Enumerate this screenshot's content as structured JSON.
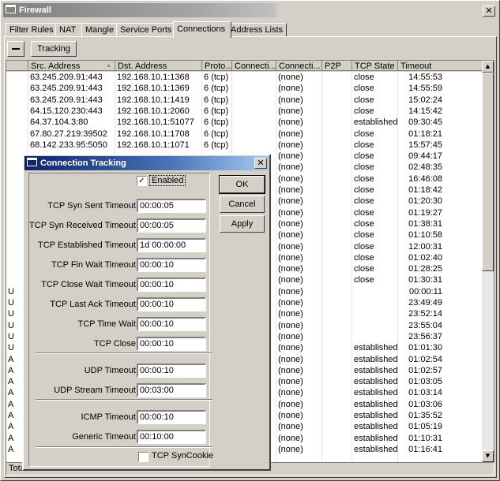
{
  "window": {
    "title": "Firewall",
    "close_glyph": "✕"
  },
  "tabs": [
    {
      "label": "Filter Rules",
      "active": false
    },
    {
      "label": "NAT",
      "active": false
    },
    {
      "label": "Mangle",
      "active": false
    },
    {
      "label": "Service Ports",
      "active": false
    },
    {
      "label": "Connections",
      "active": true
    },
    {
      "label": "Address Lists",
      "active": false
    }
  ],
  "toolbar": {
    "tracking_label": "Tracking",
    "menu_icon": "minus-icon"
  },
  "table": {
    "columns": [
      "Src. Address",
      "Dst. Address",
      "Proto...",
      "Connecti...",
      "Connecti...",
      "P2P",
      "TCP State",
      "Timeout"
    ],
    "sort_indicator": "▲",
    "rows": [
      {
        "flag": "",
        "src": "63.245.209.91:443",
        "dst": "192.168.10.1:1368",
        "proto": "6 (tcp)",
        "c2": "(none)",
        "state": "close",
        "timeout": "14:55:53"
      },
      {
        "flag": "",
        "src": "63.245.209.91:443",
        "dst": "192.168.10.1:1369",
        "proto": "6 (tcp)",
        "c2": "(none)",
        "state": "close",
        "timeout": "14:55:59"
      },
      {
        "flag": "",
        "src": "63.245.209.91:443",
        "dst": "192.168.10.1:1419",
        "proto": "6 (tcp)",
        "c2": "(none)",
        "state": "close",
        "timeout": "15:02:24"
      },
      {
        "flag": "",
        "src": "64.15.120.230:443",
        "dst": "192.168.10.1:2060",
        "proto": "6 (tcp)",
        "c2": "(none)",
        "state": "close",
        "timeout": "14:15:42"
      },
      {
        "flag": "",
        "src": "64.37.104.3:80",
        "dst": "192.168.10.1:51077",
        "proto": "6 (tcp)",
        "c2": "(none)",
        "state": "established",
        "timeout": "09:30:45"
      },
      {
        "flag": "",
        "src": "67.80.27.219:39502",
        "dst": "192.168.10.1:1708",
        "proto": "6 (tcp)",
        "c2": "(none)",
        "state": "close",
        "timeout": "01:18:21"
      },
      {
        "flag": "",
        "src": "68.142.233.95:5050",
        "dst": "192.168.10.1:1071",
        "proto": "6 (tcp)",
        "c2": "(none)",
        "state": "close",
        "timeout": "15:57:45"
      },
      {
        "flag": "",
        "src": "",
        "dst": "",
        "proto": "",
        "c2": "(none)",
        "state": "close",
        "timeout": "09:44:17"
      },
      {
        "flag": "",
        "src": "",
        "dst": "",
        "proto": "",
        "c2": "(none)",
        "state": "close",
        "timeout": "02:48:35"
      },
      {
        "flag": "",
        "src": "",
        "dst": "",
        "proto": "",
        "c2": "(none)",
        "state": "close",
        "timeout": "16:46:08"
      },
      {
        "flag": "",
        "src": "",
        "dst": "",
        "proto": "",
        "c2": "(none)",
        "state": "close",
        "timeout": "01:18:42"
      },
      {
        "flag": "",
        "src": "",
        "dst": "",
        "proto": "",
        "c2": "(none)",
        "state": "close",
        "timeout": "01:20:30"
      },
      {
        "flag": "",
        "src": "",
        "dst": "",
        "proto": "",
        "c2": "(none)",
        "state": "close",
        "timeout": "01:19:27"
      },
      {
        "flag": "",
        "src": "",
        "dst": "",
        "proto": "",
        "c2": "(none)",
        "state": "close",
        "timeout": "01:38:31"
      },
      {
        "flag": "",
        "src": "",
        "dst": "",
        "proto": "",
        "c2": "(none)",
        "state": "close",
        "timeout": "01:10:58"
      },
      {
        "flag": "",
        "src": "",
        "dst": "",
        "proto": "",
        "c2": "(none)",
        "state": "close",
        "timeout": "12:00:31"
      },
      {
        "flag": "",
        "src": "",
        "dst": "",
        "proto": "",
        "c2": "(none)",
        "state": "close",
        "timeout": "01:02:40"
      },
      {
        "flag": "",
        "src": "",
        "dst": "",
        "proto": "",
        "c2": "(none)",
        "state": "close",
        "timeout": "01:28:25"
      },
      {
        "flag": "",
        "src": "",
        "dst": "",
        "proto": "",
        "c2": "(none)",
        "state": "close",
        "timeout": "01:30:31"
      },
      {
        "flag": "U",
        "src": "",
        "dst": "",
        "proto": "",
        "c2": "(none)",
        "state": "",
        "timeout": "00:00:11"
      },
      {
        "flag": "U",
        "src": "",
        "dst": "",
        "proto": "",
        "c2": "(none)",
        "state": "",
        "timeout": "23:49:49"
      },
      {
        "flag": "U",
        "src": "",
        "dst": "",
        "proto": "",
        "c2": "(none)",
        "state": "",
        "timeout": "23:52:14"
      },
      {
        "flag": "U",
        "src": "",
        "dst": "",
        "proto": "",
        "c2": "(none)",
        "state": "",
        "timeout": "23:55:04"
      },
      {
        "flag": "U",
        "src": "",
        "dst": "",
        "proto": "",
        "c2": "(none)",
        "state": "",
        "timeout": "23:56:37"
      },
      {
        "flag": "U",
        "src": "",
        "dst": "",
        "proto": "",
        "c2": "(none)",
        "state": "established",
        "timeout": "01:01:30"
      },
      {
        "flag": "A",
        "src": "",
        "dst": "",
        "proto": "",
        "c2": "(none)",
        "state": "established",
        "timeout": "01:02:54"
      },
      {
        "flag": "A",
        "src": "",
        "dst": "",
        "proto": "",
        "c2": "(none)",
        "state": "established",
        "timeout": "01:02:57"
      },
      {
        "flag": "A",
        "src": "",
        "dst": "",
        "proto": "",
        "c2": "(none)",
        "state": "established",
        "timeout": "01:03:05"
      },
      {
        "flag": "A",
        "src": "",
        "dst": "",
        "proto": "",
        "c2": "(none)",
        "state": "established",
        "timeout": "01:03:14"
      },
      {
        "flag": "A",
        "src": "",
        "dst": "",
        "proto": "",
        "c2": "(none)",
        "state": "established",
        "timeout": "01:03:06"
      },
      {
        "flag": "A",
        "src": "",
        "dst": "",
        "proto": "",
        "c2": "(none)",
        "state": "established",
        "timeout": "01:35:52"
      },
      {
        "flag": "A",
        "src": "",
        "dst": "",
        "proto": "",
        "c2": "(none)",
        "state": "established",
        "timeout": "01:05:19"
      },
      {
        "flag": "A",
        "src": "",
        "dst": "",
        "proto": "",
        "c2": "(none)",
        "state": "established",
        "timeout": "01:10:31"
      },
      {
        "flag": "A",
        "src": "",
        "dst": "",
        "proto": "",
        "c2": "(none)",
        "state": "established",
        "timeout": "01:16:41"
      }
    ]
  },
  "status_text": "Tota",
  "dialog": {
    "title": "Connection Tracking",
    "enabled_label": "Enabled",
    "enabled_checked": "✓",
    "ok_label": "OK",
    "cancel_label": "Cancel",
    "apply_label": "Apply",
    "fields": [
      {
        "label": "TCP Syn Sent Timeout:",
        "value": "00:00:05"
      },
      {
        "label": "TCP Syn Received Timeout:",
        "value": "00:00:05"
      },
      {
        "label": "TCP Established Timeout:",
        "value": "1d 00:00:00"
      },
      {
        "label": "TCP Fin Wait Timeout:",
        "value": "00:00:10"
      },
      {
        "label": "TCP Close Wait Timeout:",
        "value": "00:00:10"
      },
      {
        "label": "TCP Last Ack Timeout:",
        "value": "00:00:10"
      },
      {
        "label": "TCP Time Wait:",
        "value": "00:00:10"
      },
      {
        "label": "TCP Close:",
        "value": "00:00:10"
      },
      {
        "label": "UDP Timeout:",
        "value": "00:00:10"
      },
      {
        "label": "UDP Stream Timeout:",
        "value": "00:03:00"
      },
      {
        "label": "ICMP Timeout:",
        "value": "00:00:10"
      },
      {
        "label": "Generic Timeout:",
        "value": "00:10:00"
      }
    ],
    "syncookie_label": "TCP SynCookie"
  },
  "colors": {
    "face": "#d4d0c8",
    "title_active": "#0a246a",
    "title_inactive": "#808080"
  }
}
